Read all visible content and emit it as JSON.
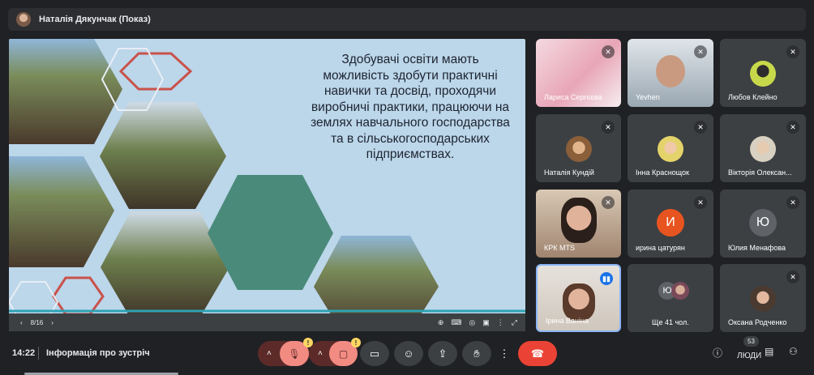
{
  "presenter": {
    "title": "Наталія Дякунчак (Показ)"
  },
  "slide": {
    "text": "Здобувачі освіти мають можливість здобути практичні навички та досвід, проходячи виробничі практики, працюючи на землях навчального господарства та в сільськогосподарських підприємствах.",
    "page": "8/16",
    "prev_icon": "chevron-left-icon",
    "next_icon": "chevron-right-icon"
  },
  "participants": [
    {
      "name": "Лариса Сергєєва",
      "muted": true
    },
    {
      "name": "Yevhen",
      "muted": true
    },
    {
      "name": "Любов Клейно",
      "muted": true
    },
    {
      "name": "Наталія Кундій",
      "muted": true
    },
    {
      "name": "Інна Краснощок",
      "muted": true
    },
    {
      "name": "Вікторія Олексан...",
      "muted": true
    },
    {
      "name": "КРК MTS",
      "muted": true
    },
    {
      "name": "ирина цатурян",
      "muted": true,
      "initial": "И",
      "color": "#e8541f"
    },
    {
      "name": "Юлия Менафова",
      "muted": true,
      "initial": "Ю",
      "color": "#5f6368"
    },
    {
      "name": "Ірина Ваніна",
      "speaking": true
    },
    {
      "name": "Ще 41 чол.",
      "initial": "Ю"
    },
    {
      "name": "Оксана Родченко",
      "muted": true
    }
  ],
  "bottom": {
    "time": "14:22",
    "meeting_info": "Інформація про зустріч",
    "badge_mic": "!",
    "badge_cam": "!",
    "people_count": "53",
    "people_label": "ЛЮДИ"
  },
  "colors": {
    "accent": "#8ab4f8",
    "danger": "#ea4335",
    "muted_bg": "#f28b82"
  }
}
